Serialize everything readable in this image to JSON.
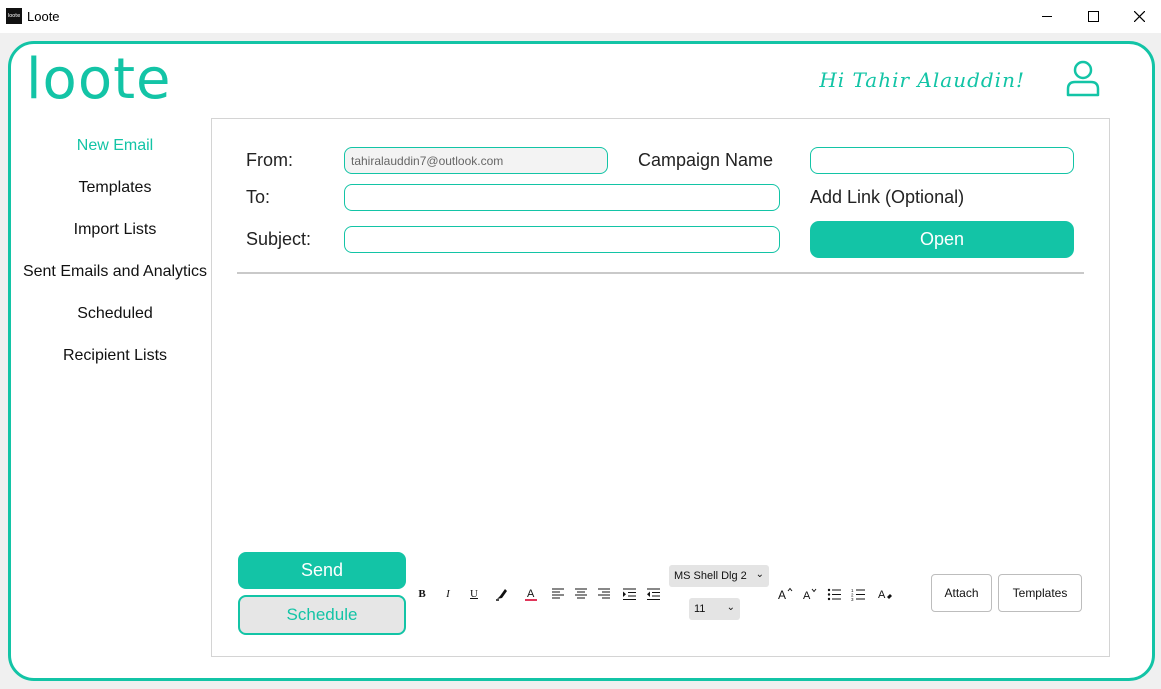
{
  "window": {
    "title": "Loote",
    "app_icon_text": "loote"
  },
  "brand": {
    "logo": "loote",
    "accent": "#13c4a6"
  },
  "header": {
    "greeting": "Hi Tahir Alauddin!"
  },
  "sidebar": {
    "items": [
      {
        "label": "New Email",
        "active": true
      },
      {
        "label": "Templates"
      },
      {
        "label": "Import Lists"
      },
      {
        "label": "Sent Emails and Analytics"
      },
      {
        "label": "Scheduled"
      },
      {
        "label": "Recipient Lists"
      }
    ]
  },
  "form": {
    "from_label": "From:",
    "from_value": "tahiralauddin7@outlook.com",
    "to_label": "To:",
    "to_value": "",
    "subject_label": "Subject:",
    "subject_value": "",
    "campaign_label": "Campaign Name",
    "campaign_value": "",
    "link_label": "Add Link (Optional)",
    "open_button": "Open"
  },
  "actions": {
    "send": "Send",
    "schedule": "Schedule"
  },
  "toolbar": {
    "bold": "B",
    "italic": "I",
    "underline": "U",
    "font_name": "MS Shell Dlg 2",
    "font_size": "11",
    "attach": "Attach",
    "templates": "Templates"
  }
}
